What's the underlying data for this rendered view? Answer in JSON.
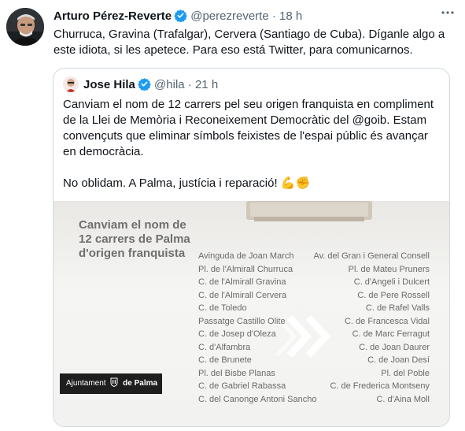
{
  "tweet": {
    "author_name": "Arturo Pérez-Reverte",
    "handle": "@perezreverte",
    "separator": "·",
    "time": "18 h",
    "more_icon": "more-horizontal-icon",
    "text": "Churruca, Gravina (Trafalgar), Cervera (Santiago de Cuba). Díganle algo a este idiota, si les apetece. Para eso está Twitter, para comunicarnos."
  },
  "quote": {
    "author_name": "Jose Hila",
    "handle": "@hila",
    "separator": "·",
    "time": "21 h",
    "text_p1": "Canviam el nom de 12 carrers pel seu origen franquista en compliment de la Llei de Memòria i Reconeixement Democràtic del @goib. Estam convençuts que eliminar símbols feixistes de l'espai públic és avançar en democràcia.",
    "text_p2": "No oblidam.  A Palma, justícia i reparació! 💪✊"
  },
  "image": {
    "title": "Canviam el nom de 12 carrers de Palma d'origen franquista",
    "left_streets": [
      "Avinguda de Joan March",
      "Pl. de l'Almirall Churruca",
      "C. de l'Almirall Gravina",
      "C. de l'Almirall Cervera",
      "C. de Toledo",
      "Passatge Castillo Olite",
      "C. de Josep d'Oleza",
      "C. d'Alfambra",
      "C. de Brunete",
      "Pl. del Bisbe Planas",
      "C. de Gabriel Rabassa",
      "C. del Canonge Antoni Sancho"
    ],
    "right_streets": [
      "Av. del Gran i General Consell",
      "Pl. de Mateu Pruners",
      "C. d'Angeli i Dulcert",
      "C. de Pere Rossell",
      "C. de Rafel Valls",
      "C. de Francesca Vidal",
      "C. de Marc Ferragut",
      "C. de Joan Daurer",
      "C. de Joan Desí",
      "Pl. del Poble",
      "C. de Frederica Montseny",
      "C. d'Aina Moll"
    ],
    "logo_prefix": "Ajuntament",
    "logo_name": "de Palma"
  },
  "colors": {
    "verified": "#1d9bf0",
    "muted_text": "#536471",
    "border": "#cfd9de"
  }
}
